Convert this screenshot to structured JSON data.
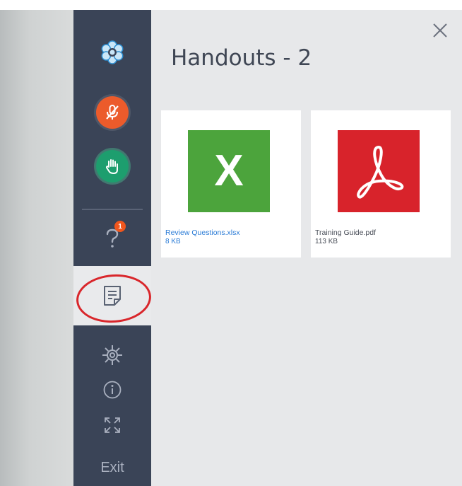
{
  "panel": {
    "title": "Handouts - 2"
  },
  "sidebar": {
    "question_badge": "1",
    "exit_label": "Exit"
  },
  "handouts": [
    {
      "name": "Review Questions.xlsx",
      "size": "8 KB",
      "type": "xlsx",
      "thumb_letter": "X",
      "thumb_color": "#4ca43c"
    },
    {
      "name": "Training Guide.pdf",
      "size": "113 KB",
      "type": "pdf",
      "thumb_color": "#d8232b"
    }
  ],
  "colors": {
    "sidebar": "#3a4457",
    "panel": "#e7e8ea",
    "mic_button": "#ec5b2b",
    "hand_button": "#1d9e6e",
    "badge": "#f0561d",
    "highlight_ring": "#d9262b",
    "link_blue": "#2a7bd6"
  },
  "icons": [
    "gotowebinar-logo-icon",
    "microphone-muted-icon",
    "raise-hand-icon",
    "question-icon",
    "handouts-icon",
    "gear-icon",
    "info-icon",
    "fullscreen-icon",
    "close-icon",
    "excel-file-icon",
    "pdf-file-icon"
  ]
}
